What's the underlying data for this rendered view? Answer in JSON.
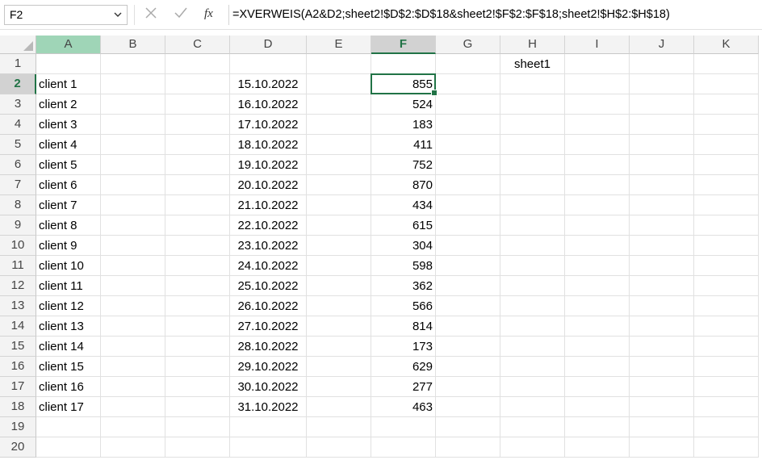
{
  "name_box": "F2",
  "formula": "=XVERWEIS(A2&D2;sheet2!$D$2:$D$18&sheet2!$F$2:$F$18;sheet2!$H$2:$H$18)",
  "columns": [
    "A",
    "B",
    "C",
    "D",
    "E",
    "F",
    "G",
    "H",
    "I",
    "J",
    "K"
  ],
  "rows": [
    "1",
    "2",
    "3",
    "4",
    "5",
    "6",
    "7",
    "8",
    "9",
    "10",
    "11",
    "12",
    "13",
    "14",
    "15",
    "16",
    "17",
    "18",
    "19",
    "20"
  ],
  "cells": {
    "H1": "sheet1",
    "A2": "client 1",
    "D2": "15.10.2022",
    "F2": "855",
    "A3": "client 2",
    "D3": "16.10.2022",
    "F3": "524",
    "A4": "client 3",
    "D4": "17.10.2022",
    "F4": "183",
    "A5": "client 4",
    "D5": "18.10.2022",
    "F5": "411",
    "A6": "client 5",
    "D6": "19.10.2022",
    "F6": "752",
    "A7": "client 6",
    "D7": "20.10.2022",
    "F7": "870",
    "A8": "client 7",
    "D8": "21.10.2022",
    "F8": "434",
    "A9": "client 8",
    "D9": "22.10.2022",
    "F9": "615",
    "A10": "client 9",
    "D10": "23.10.2022",
    "F10": "304",
    "A11": "client 10",
    "D11": "24.10.2022",
    "F11": "598",
    "A12": "client 11",
    "D12": "25.10.2022",
    "F12": "362",
    "A13": "client 12",
    "D13": "26.10.2022",
    "F13": "566",
    "A14": "client 13",
    "D14": "27.10.2022",
    "F14": "814",
    "A15": "client 14",
    "D15": "28.10.2022",
    "F15": "173",
    "A16": "client 15",
    "D16": "29.10.2022",
    "F16": "629",
    "A17": "client 16",
    "D17": "30.10.2022",
    "F17": "277",
    "A18": "client 17",
    "D18": "31.10.2022",
    "F18": "463"
  },
  "selected_cell": "F2",
  "accent_color": "#217346",
  "icons": {
    "cancel": "x-icon",
    "enter": "check-icon",
    "function": "fx-icon",
    "dropdown": "chevron-down-icon"
  }
}
